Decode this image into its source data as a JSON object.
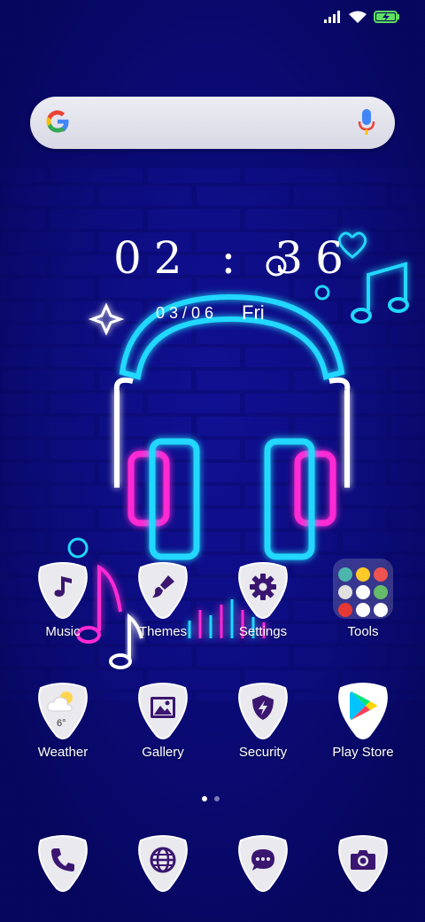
{
  "clock": {
    "time": "02 : 36",
    "date": "03/06",
    "day": "Fri"
  },
  "search": {
    "provider_icon": "google-g-icon",
    "mic_icon": "mic-icon"
  },
  "status": {
    "signal": "signal-icon",
    "wifi": "wifi-icon",
    "battery": "battery-charging-icon"
  },
  "apps": [
    {
      "label": "Music",
      "icon": "music-note-icon"
    },
    {
      "label": "Themes",
      "icon": "paintbrush-icon"
    },
    {
      "label": "Settings",
      "icon": "gear-icon"
    },
    {
      "label": "Tools",
      "icon": "folder-icon"
    },
    {
      "label": "Weather",
      "icon": "weather-icon",
      "temp": "6°"
    },
    {
      "label": "Gallery",
      "icon": "gallery-icon"
    },
    {
      "label": "Security",
      "icon": "security-shield-icon"
    },
    {
      "label": "Play Store",
      "icon": "play-store-icon"
    }
  ],
  "dock": [
    {
      "icon": "phone-icon"
    },
    {
      "icon": "browser-icon"
    },
    {
      "icon": "messages-icon"
    },
    {
      "icon": "camera-icon"
    }
  ],
  "page_indicator": {
    "pages": 2,
    "current": 1
  },
  "colors": {
    "background": "#0c0c7e",
    "neon_cyan": "#20d8ff",
    "neon_pink": "#ff2ad4",
    "icon_purple": "#3a1670"
  }
}
